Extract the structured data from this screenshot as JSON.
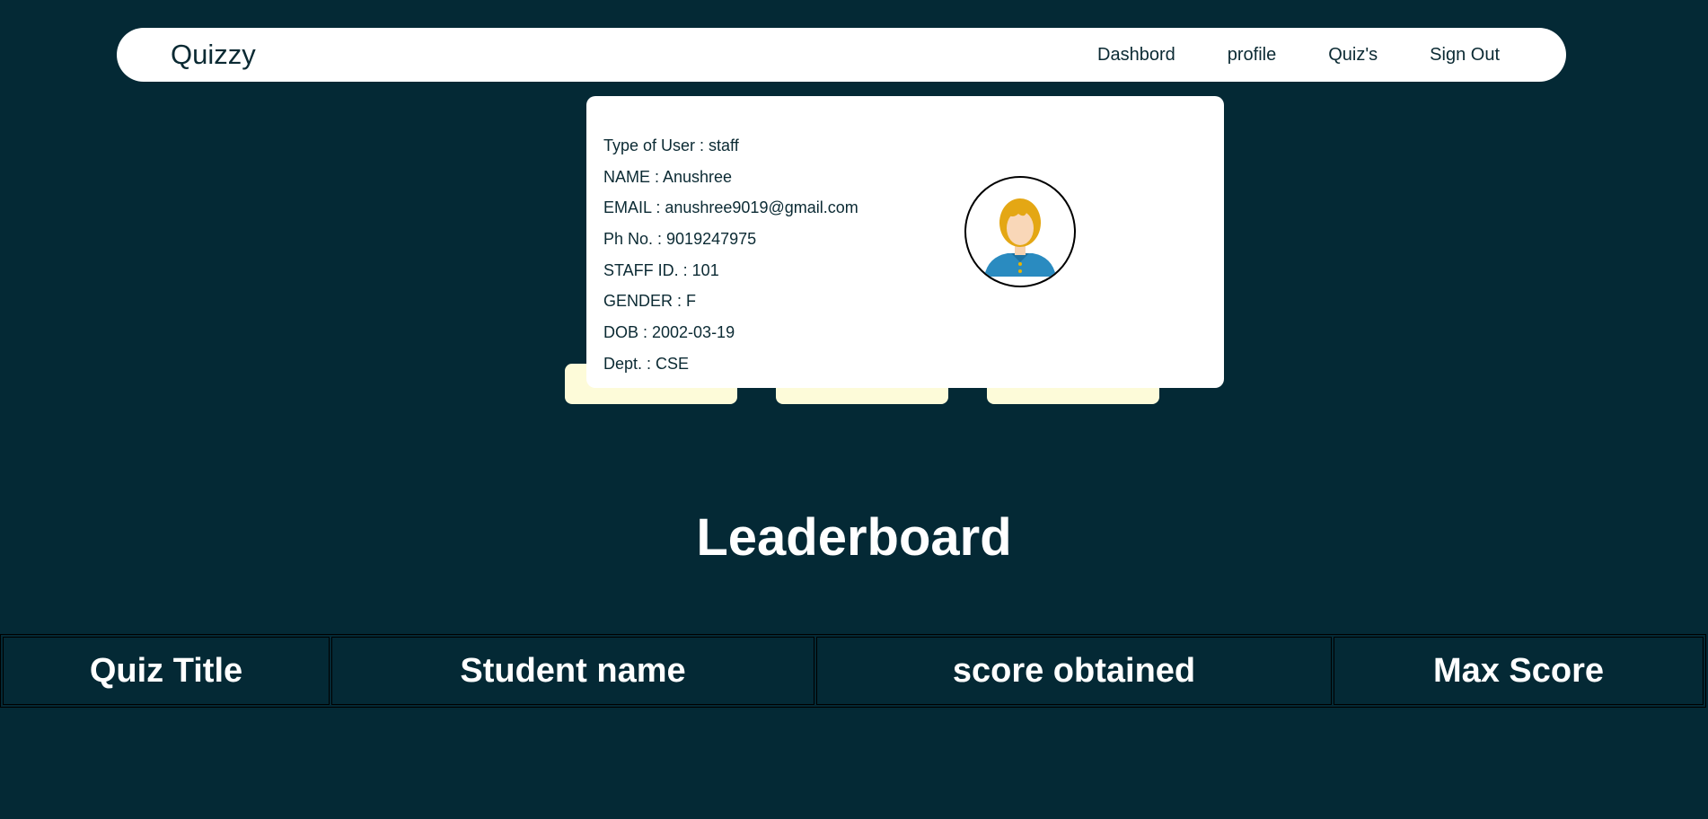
{
  "navbar": {
    "brand": "Quizzy",
    "links": [
      "Dashbord",
      "profile",
      "Quiz's",
      "Sign Out"
    ]
  },
  "profile": {
    "rows": [
      "Type of User : staff",
      "NAME : Anushree",
      "EMAIL : anushree9019@gmail.com",
      "Ph No. : 9019247975",
      "STAFF ID. : 101",
      "GENDER : F",
      "DOB : 2002-03-19",
      "Dept. : CSE"
    ],
    "avatar_icon": "female-user-avatar-icon"
  },
  "leaderboard": {
    "title": "Leaderboard",
    "columns": [
      "Quiz Title",
      "Student name",
      "score obtained",
      "Max Score"
    ]
  },
  "colors": {
    "background": "#042935",
    "card": "#ffffff",
    "tile": "#fdfbd9",
    "text_dark": "#0b2a33"
  }
}
